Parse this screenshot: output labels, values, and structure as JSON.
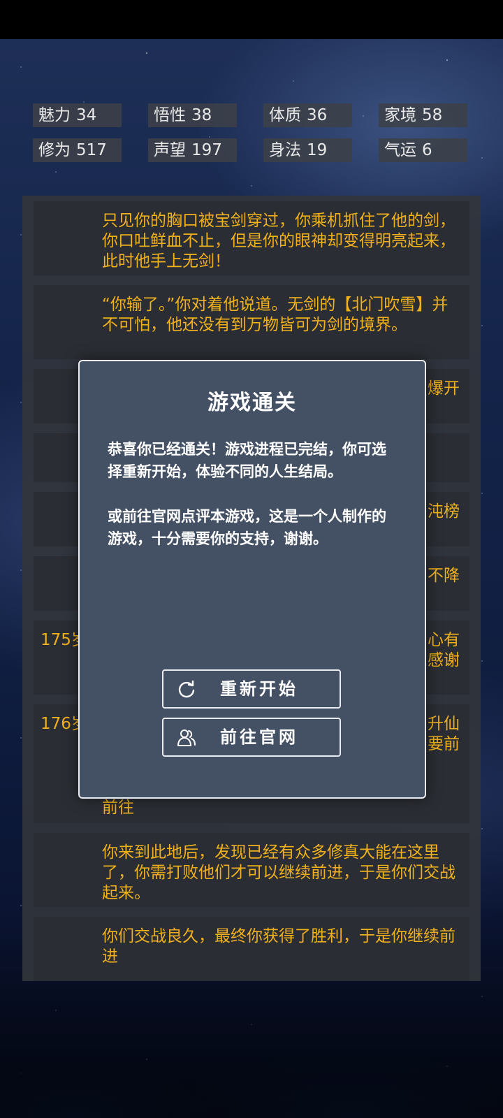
{
  "stats": [
    {
      "label": "魅力",
      "value": "34"
    },
    {
      "label": "悟性",
      "value": "38"
    },
    {
      "label": "体质",
      "value": "36"
    },
    {
      "label": "家境",
      "value": "58"
    },
    {
      "label": "修为",
      "value": "517"
    },
    {
      "label": "声望",
      "value": "197"
    },
    {
      "label": "身法",
      "value": "19"
    },
    {
      "label": "气运",
      "value": "6"
    }
  ],
  "log": [
    {
      "age": "",
      "text": "只见你的胸口被宝剑穿过，你乘机抓住了他的剑，你口吐鲜血不止，但是你的眼神却变得明亮起来，此时他手上无剑！"
    },
    {
      "age": "",
      "text": "“你输了。”你对着他说道。无剑的【北门吹雪】并不可怕，他还没有到万物皆可为剑的境界。"
    },
    {
      "age": "",
      "text": "",
      "right": "爆开"
    },
    {
      "age": "",
      "text": "",
      "right": ""
    },
    {
      "age": "",
      "text": "",
      "right": "沌榜"
    },
    {
      "age": "",
      "text": "",
      "right": "不降"
    },
    {
      "age": "175岁",
      "text": "",
      "right": "心有\n感谢"
    },
    {
      "age": "176岁",
      "text": "",
      "right": "升仙\n要前",
      "tail": "前往"
    },
    {
      "age": "",
      "text": "你来到此地后，发现已经有众多修真大能在这里了，你需打败他们才可以继续前进，于是你们交战起来。"
    },
    {
      "age": "",
      "text": "你们交战良久，最终你获得了胜利，于是你继续前进"
    }
  ],
  "modal": {
    "title": "游戏通关",
    "paragraph1": "恭喜你已经通关！游戏进程已完结，你可选择重新开始，体验不同的人生结局。",
    "paragraph2": "或前往官网点评本游戏，这是一个人制作的游戏，十分需要你的支持，谢谢。",
    "restart_label": "重新开始",
    "website_label": "前往官网"
  },
  "colors": {
    "log_text": "#f0b11c",
    "modal_bg": "#445164",
    "stat_bg": "#3c4048"
  },
  "icons": {
    "restart": "refresh-icon",
    "website": "users-icon"
  }
}
